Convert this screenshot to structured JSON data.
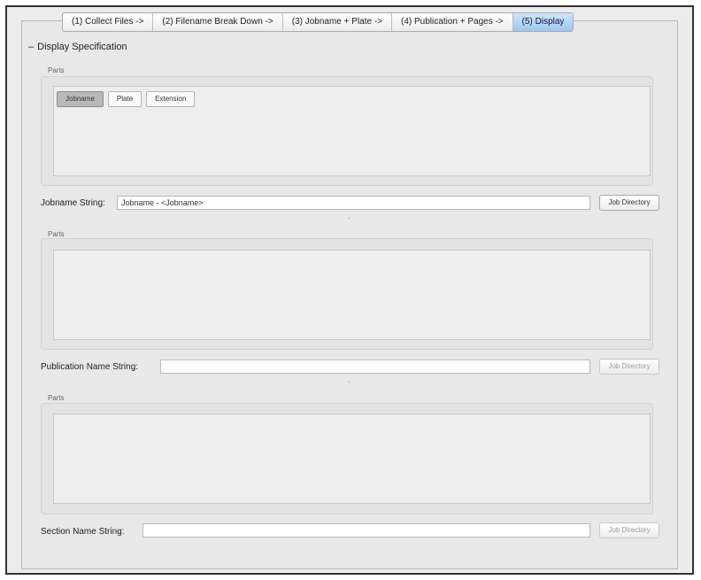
{
  "tabs": [
    {
      "label": "(1) Collect Files ->"
    },
    {
      "label": "(2) Filename Break Down ->"
    },
    {
      "label": "(3) Jobname + Plate ->"
    },
    {
      "label": "(4) Publication + Pages ->"
    },
    {
      "label": "(5) Display"
    }
  ],
  "selected_tab": "(5) Display",
  "section": {
    "toggle_symbol": "–",
    "title": "Display Specification"
  },
  "jobname_group": {
    "parts_label": "Parts",
    "chips": [
      {
        "label": "Jobname",
        "active": true
      },
      {
        "label": "Plate",
        "active": false
      },
      {
        "label": "Extension",
        "active": false
      }
    ],
    "field_label": "Jobname String:",
    "field_value": "Jobname - <Jobname>",
    "button_label": "Job Directory",
    "splitter": "ˇ"
  },
  "publication_group": {
    "parts_label": "Parts",
    "field_label": "Publication Name String:",
    "field_value": "",
    "button_label": "Job Directory",
    "splitter": "ˇ"
  },
  "section_group": {
    "parts_label": "Parts",
    "field_label": "Section Name String:",
    "field_value": "",
    "button_label": "Job Directory"
  }
}
